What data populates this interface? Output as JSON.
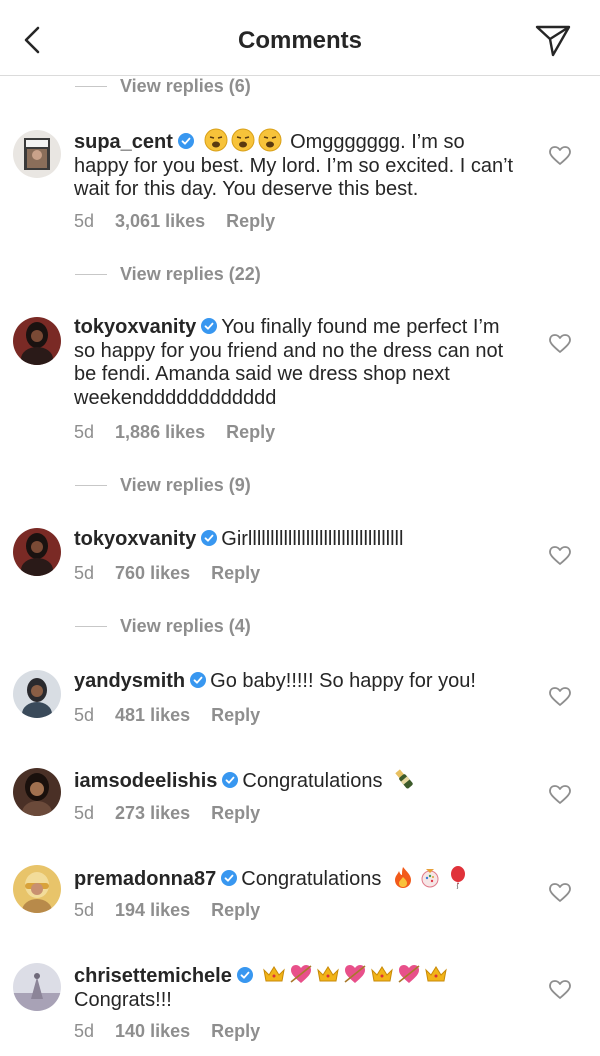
{
  "header": {
    "title": "Comments"
  },
  "view_replies": [
    {
      "label": "View replies (6)"
    },
    {
      "label": "View replies (22)"
    },
    {
      "label": "View replies (9)"
    },
    {
      "label": "View replies (4)"
    }
  ],
  "comments": [
    {
      "username": "supa_cent",
      "text": "Omggggggg. I’m so happy for you best. My lord. I’m so excited. I can’t wait for this day. You deserve this best.",
      "emojis": [
        "weary-face",
        "weary-face",
        "weary-face"
      ],
      "time": "5d",
      "likes": "3,061 likes",
      "reply": "Reply",
      "avatar_color": "#c9c2b8"
    },
    {
      "username": "tokyoxvanity",
      "text": "You finally found me perfect I’m so happy for you friend and no the dress can not be fendi. Amanda said we dress shop next weekendddddddddddd",
      "time": "5d",
      "likes": "1,886 likes",
      "reply": "Reply",
      "avatar_color": "#7a2a25"
    },
    {
      "username": "tokyoxvanity",
      "text": "Girlllllllllllllllllllllllllllllllllll",
      "time": "5d",
      "likes": "760 likes",
      "reply": "Reply",
      "avatar_color": "#7a2a25"
    },
    {
      "username": "yandysmith",
      "text": "Go baby!!!!! So happy for you!",
      "time": "5d",
      "likes": "481 likes",
      "reply": "Reply",
      "avatar_color": "#4a5a6a"
    },
    {
      "username": "iamsodeelishis",
      "text": "Congratulations",
      "emojis_after": [
        "champagne"
      ],
      "time": "5d",
      "likes": "273 likes",
      "reply": "Reply",
      "avatar_color": "#6b4a3a"
    },
    {
      "username": "premadonna87",
      "text": "Congratulations",
      "emojis_after": [
        "fire",
        "confetti",
        "balloon"
      ],
      "time": "5d",
      "likes": "194 likes",
      "reply": "Reply",
      "avatar_color": "#d9a23a"
    },
    {
      "username": "chrisettemichele",
      "text": "Congrats!!!",
      "emojis": [
        "crown",
        "heart-arrow",
        "crown",
        "heart-arrow",
        "crown",
        "heart-arrow",
        "crown"
      ],
      "time": "5d",
      "likes": "140 likes",
      "reply": "Reply",
      "avatar_color": "#b9b4c8"
    }
  ],
  "colors": {
    "verified": "#3897f0",
    "secondary_text": "#8e8e8e",
    "primary_text": "#262626"
  }
}
